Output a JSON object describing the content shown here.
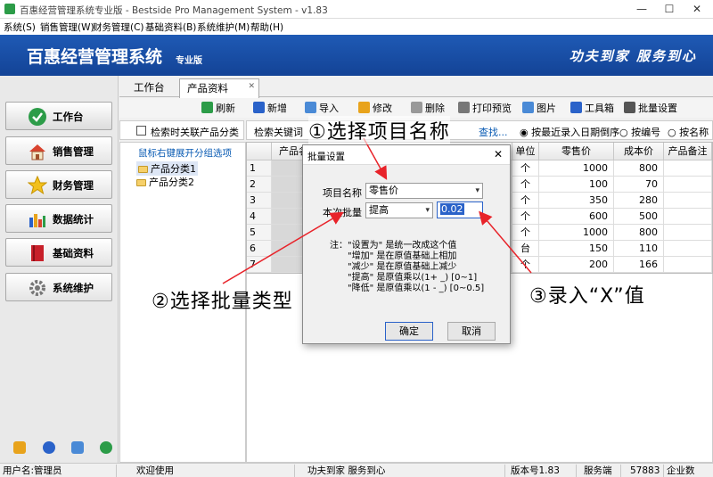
{
  "window": {
    "title": "百惠经营管理系统专业版 - Bestside Pro Management System - v1.83",
    "min": "—",
    "max": "☐",
    "close": "✕"
  },
  "menu": [
    "系统(S)",
    "销售管理(W)",
    "财务管理(C)",
    "基础资料(B)",
    "系统维护(M)",
    "帮助(H)"
  ],
  "banner": {
    "title": "百惠经营管理系统",
    "subtitle": "专业版",
    "slogan": "功夫到家 服务到心",
    "bg": "#1f5ab5"
  },
  "nav": [
    {
      "label": "工作台",
      "icon": "check-circle-icon",
      "color": "#2c9c48"
    },
    {
      "label": "销售管理",
      "icon": "house-icon",
      "color": "#d9432e"
    },
    {
      "label": "财务管理",
      "icon": "star-icon",
      "color": "#f2c01c"
    },
    {
      "label": "数据统计",
      "icon": "bar-chart-icon",
      "color": "#2a62c9"
    },
    {
      "label": "基础资料",
      "icon": "book-icon",
      "color": "#c8202a"
    },
    {
      "label": "系统维护",
      "icon": "gear-icon",
      "color": "#777777"
    }
  ],
  "tabs": {
    "work": "工作台",
    "product": "产品资料",
    "close": "✕"
  },
  "toolbar": [
    "刷新",
    "新增",
    "导入",
    "修改",
    "删除",
    "打印预览",
    "图片",
    "工具箱",
    "批量设置"
  ],
  "filter": {
    "related_label": "检索时关联产品分类",
    "search_label": "检索关键词",
    "find": "查找...",
    "sort": [
      "按最近录入日期倒序",
      "按编号",
      "按名称"
    ]
  },
  "tree": {
    "hint": "鼠标右键展开分组选项",
    "items": [
      "产品分类1",
      "产品分类2"
    ]
  },
  "grid": {
    "headers": [
      "",
      "产品名",
      "单位",
      "零售价",
      "成本价",
      "产品备注"
    ],
    "rows": [
      {
        "no": "1",
        "unit": "个",
        "price": "1000",
        "cost": "800"
      },
      {
        "no": "2",
        "unit": "个",
        "price": "100",
        "cost": "70"
      },
      {
        "no": "3",
        "unit": "个",
        "price": "350",
        "cost": "280"
      },
      {
        "no": "4",
        "unit": "个",
        "price": "600",
        "cost": "500"
      },
      {
        "no": "5",
        "unit": "个",
        "price": "1000",
        "cost": "800"
      },
      {
        "no": "6",
        "unit": "台",
        "price": "150",
        "cost": "110"
      },
      {
        "no": "7",
        "unit": "个",
        "price": "200",
        "cost": "166"
      }
    ]
  },
  "dialog": {
    "title": "批量设置",
    "item_label": "项目名称",
    "item_value": "零售价",
    "batch_label": "本次批量",
    "batch_value": "提高",
    "x_value": "0.02",
    "notes": [
      "注：\"设置为\" 是统一改成这个值",
      "\"增加\" 是在原值基础上相加",
      "\"减少\" 是在原值基础上减少",
      "\"提高\" 是原值乘以(1+ _) [0~1]",
      "\"降低\" 是原值乘以(1 - _) [0~0.5]"
    ],
    "ok": "确定",
    "cancel": "取消"
  },
  "annotations": {
    "a1": "①选择项目名称",
    "a2": "②选择批量类型",
    "a3": "③录入“X”值",
    "arrow_color": "#e8232a"
  },
  "status": {
    "user": "用户名:管理员",
    "welcome": "欢迎使用",
    "slogan": "功夫到家 服务到心",
    "version": "版本号1.83",
    "server": "服务端",
    "code": "57883",
    "edition": "企业数"
  }
}
